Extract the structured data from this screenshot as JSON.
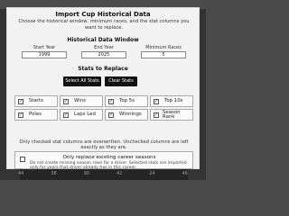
{
  "dialog": {
    "title": "Import Cup Historical Data",
    "subtitle": "Choose the historical window, minimum races, and the stat columns you want to replace.",
    "window_heading": "Historical Data Window",
    "start_year_label": "Start Year",
    "start_year_value": "1999",
    "end_year_label": "End Year",
    "end_year_value": "2025",
    "min_races_label": "Minimum Races",
    "min_races_value": "5",
    "stats_heading": "Stats to Replace",
    "select_all_label": "Select All Stats",
    "clear_label": "Clear Stats",
    "stats": [
      {
        "label": "Starts",
        "checked": true
      },
      {
        "label": "Wins",
        "checked": true
      },
      {
        "label": "Top 5s",
        "checked": true
      },
      {
        "label": "Top 10s",
        "checked": true
      },
      {
        "label": "Poles",
        "checked": true
      },
      {
        "label": "Laps Led",
        "checked": true
      },
      {
        "label": "Winnings",
        "checked": true
      },
      {
        "label": "Season Rank",
        "checked": true
      }
    ],
    "note": "Only checked stat columns are overwritten. Unchecked columns are left exactly as they are.",
    "career_title": "Only replace existing career seasons",
    "career_desc": "Do not create missing season rows for a driver. Selected stats are imported only for years that driver already has in this career.",
    "career_checked": false
  },
  "background": {
    "columns": [
      "44",
      "38",
      "90",
      "42",
      "24",
      "46"
    ]
  }
}
